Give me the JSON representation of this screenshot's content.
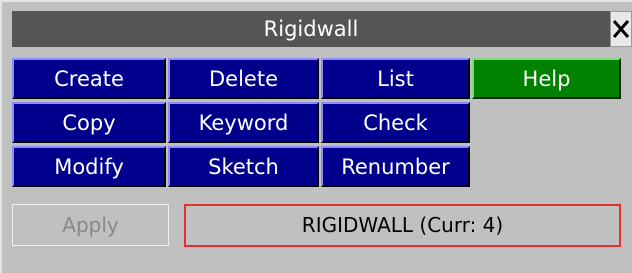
{
  "window": {
    "title": "Rigidwall"
  },
  "buttons": {
    "create": "Create",
    "delete": "Delete",
    "list": "List",
    "help": "Help",
    "copy": "Copy",
    "keyword": "Keyword",
    "check": "Check",
    "modify": "Modify",
    "sketch": "Sketch",
    "renumber": "Renumber"
  },
  "footer": {
    "apply_label": "Apply",
    "status_text": "RIGIDWALL (Curr: 4)"
  },
  "colors": {
    "button_navy": "#00008c",
    "button_help": "#008200",
    "title_bar": "#555555",
    "status_border": "#e53030"
  },
  "icons": {
    "close": "close-icon"
  }
}
